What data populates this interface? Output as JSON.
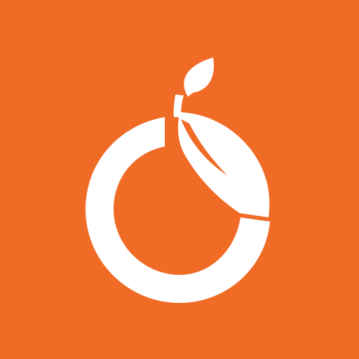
{
  "icon": {
    "name": "orange-fruit-logo",
    "background_color": "#F06B26",
    "foreground_color": "#FFFFFF"
  }
}
